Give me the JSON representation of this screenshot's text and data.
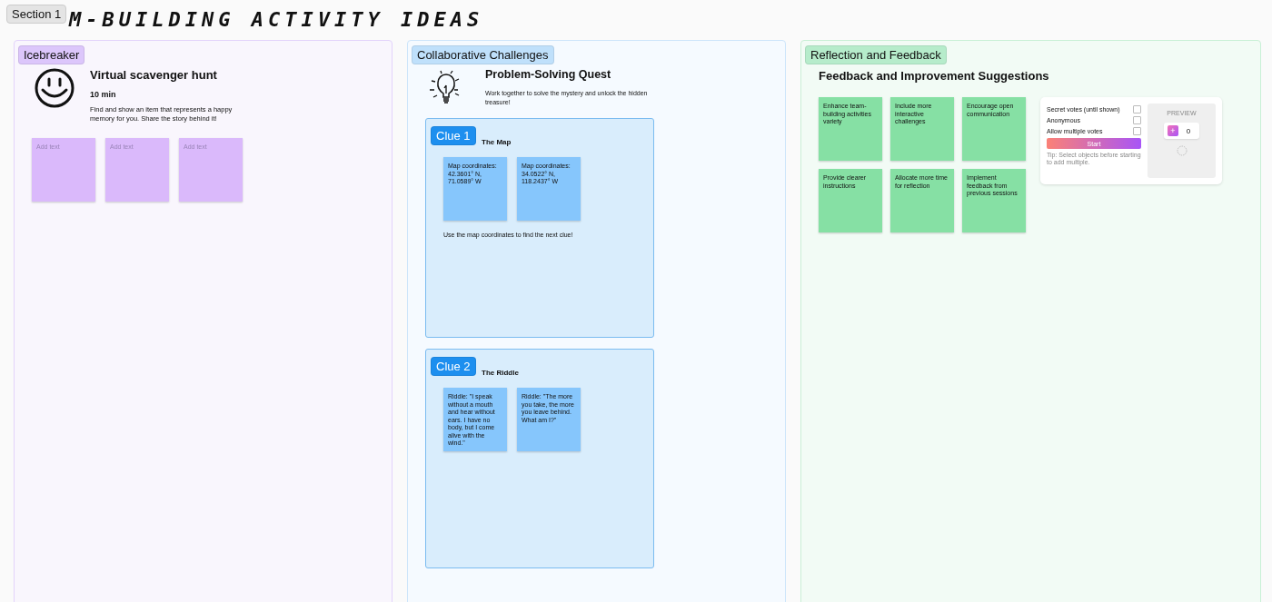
{
  "board": {
    "section_label": "Section 1",
    "title": "M-BUILDING ACTIVITY IDEAS"
  },
  "sections": [
    {
      "kind": "icebreaker",
      "label": "Icebreaker",
      "color": "#dcc6fb",
      "heading": "Virtual scavenger hunt",
      "duration": "10 min",
      "description": "Find and show an item that represents a happy memory for you. Share the story behind it!",
      "notes": [
        {
          "placeholder": "Add text"
        },
        {
          "placeholder": "Add text"
        },
        {
          "placeholder": "Add text"
        }
      ]
    },
    {
      "kind": "quest",
      "label": "Collaborative Challenges",
      "color": "#bfe0fb",
      "heading": "Problem-Solving Quest",
      "description": "Work together to solve the mystery and unlock the hidden treasure!",
      "clues": [
        {
          "badge": "Clue 1",
          "heading": "The Map",
          "notes": [
            "Map coordinates: 42.3601° N, 71.0589° W",
            "Map coordinates: 34.0522° N, 118.2437° W"
          ],
          "caption": "Use the map coordinates to find the next clue!"
        },
        {
          "badge": "Clue 2",
          "heading": "The Riddle",
          "notes": [
            "Riddle: \"I speak without a mouth and hear without ears. I have no body, but I come alive with the wind.\"",
            "Riddle: \"The more you take, the more you leave behind. What am I?\""
          ]
        }
      ]
    },
    {
      "kind": "feedback",
      "label": "Reflection and Feedback",
      "color": "#b6eccb",
      "heading": "Feedback and Improvement Suggestions",
      "notes": [
        "Enhance team-building activities variety",
        "Include more interactive challenges",
        "Encourage open communication",
        "Provide clearer instructions",
        "Allocate more time for reflection",
        "Implement feedback from previous sessions"
      ],
      "voting": {
        "options": [
          {
            "label": "Secret votes (until shown)",
            "checked": false
          },
          {
            "label": "Anonymous",
            "checked": false
          },
          {
            "label": "Allow multiple votes",
            "checked": false
          }
        ],
        "start_button": "Start",
        "tip": "Tip: Select objects before starting to add multiple.",
        "preview_label": "PREVIEW",
        "plus": "+",
        "count": "0"
      }
    }
  ]
}
